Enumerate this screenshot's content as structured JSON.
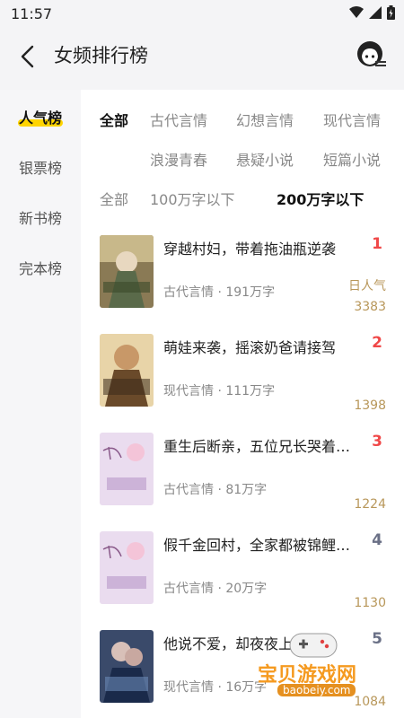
{
  "status_bar": {
    "time": "11:57"
  },
  "header": {
    "title": "女频排行榜"
  },
  "sidebar": {
    "items": [
      {
        "label": "人气榜"
      },
      {
        "label": "银票榜"
      },
      {
        "label": "新书榜"
      },
      {
        "label": "完本榜"
      }
    ]
  },
  "filters": {
    "categories": [
      "全部",
      "古代言情",
      "幻想言情",
      "现代言情",
      "浪漫青春",
      "悬疑小说",
      "短篇小说"
    ],
    "word_counts": [
      "全部",
      "100万字以下",
      "200万字以下"
    ]
  },
  "books": [
    {
      "rank": "1",
      "title": "穿越村妇，带着拖油瓶逆袭",
      "meta": "古代言情 · 191万字",
      "hot_label": "日人气",
      "hot_value": "3383",
      "rank_color": "#f04848"
    },
    {
      "rank": "2",
      "title": "萌娃来袭，摇滚奶爸请接驾",
      "meta": "现代言情 · 111万字",
      "hot_value": "1398",
      "rank_color": "#f04848"
    },
    {
      "rank": "3",
      "title": "重生后断亲，五位兄长哭着…",
      "meta": "古代言情 · 81万字",
      "hot_value": "1224",
      "rank_color": "#f04848"
    },
    {
      "rank": "4",
      "title": "假千金回村，全家都被锦鲤…",
      "meta": "古代言情 · 20万字",
      "hot_value": "1130",
      "rank_color": "#6a7086"
    },
    {
      "rank": "5",
      "title": "他说不爱，却夜夜上瘾",
      "meta": "现代言情 · 16万字",
      "hot_value": "1084",
      "rank_color": "#6a7086"
    }
  ],
  "watermark": {
    "title": "宝贝游戏网",
    "url": "baobeiy.com"
  },
  "colors": {
    "accent": "#ffd400",
    "hot": "#b8975a"
  }
}
